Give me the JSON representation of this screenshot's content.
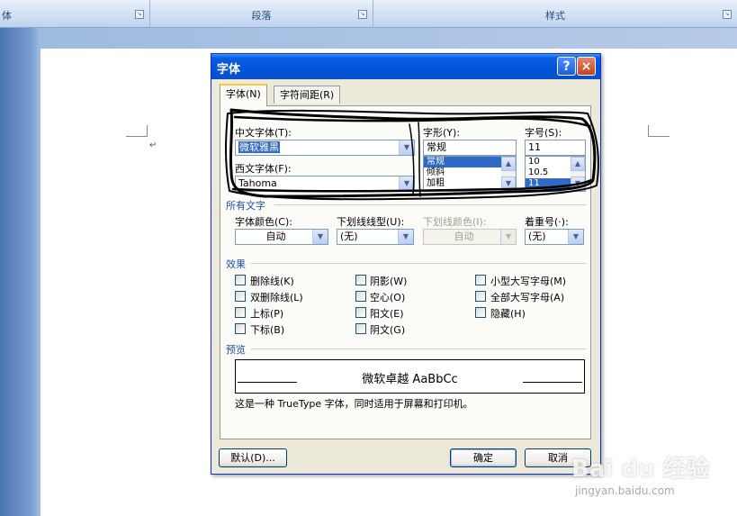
{
  "ribbon": {
    "left_label": "体",
    "paragraph_label": "段落",
    "styles_label": "样式"
  },
  "document": {
    "paragraph_mark": "↵"
  },
  "dialog": {
    "title": "字体",
    "help_label": "?",
    "close_label": "×",
    "tabs": [
      {
        "label": "字体(N)"
      },
      {
        "label": "字符间距(R)"
      }
    ],
    "chinese_font": {
      "label": "中文字体(T):",
      "value": "微软雅黑"
    },
    "western_font": {
      "label": "西文字体(F):",
      "value": "Tahoma"
    },
    "style": {
      "label": "字形(Y):",
      "value": "常规",
      "options": [
        "常规",
        "倾斜",
        "加粗"
      ],
      "selected": "常规"
    },
    "size": {
      "label": "字号(S):",
      "value": "11",
      "options": [
        "10",
        "10.5",
        "11"
      ],
      "selected": "11"
    },
    "all_text": {
      "section": "所有文字",
      "font_color": {
        "label": "字体颜色(C):",
        "value": "自动"
      },
      "underline": {
        "label": "下划线线型(U):",
        "value": "(无)"
      },
      "underline_color": {
        "label": "下划线颜色(I):",
        "value": "自动"
      },
      "emphasis": {
        "label": "着重号(·):",
        "value": "(无)"
      }
    },
    "effects": {
      "section": "效果",
      "col1": [
        "删除线(K)",
        "双删除线(L)",
        "上标(P)",
        "下标(B)"
      ],
      "col2": [
        "阴影(W)",
        "空心(O)",
        "阳文(E)",
        "阴文(G)"
      ],
      "col3": [
        "小型大写字母(M)",
        "全部大写字母(A)",
        "隐藏(H)"
      ]
    },
    "preview": {
      "section": "预览",
      "text": "微软卓越  AaBbCc",
      "note": "这是一种 TrueType 字体，同时适用于屏幕和打印机。"
    },
    "buttons": {
      "default": "默认(D)...",
      "ok": "确定",
      "cancel": "取消"
    }
  },
  "watermark": {
    "logo": "Bai du 经验",
    "url": "jingyan.baidu.com"
  }
}
